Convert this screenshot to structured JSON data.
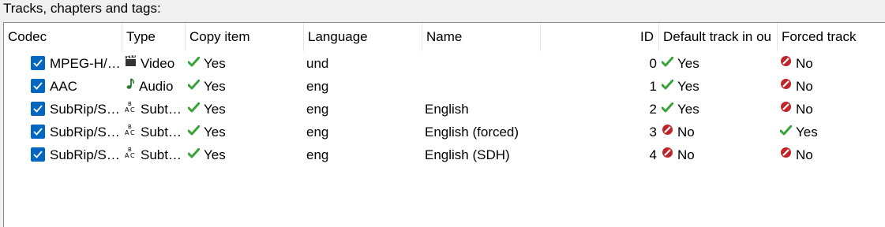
{
  "section_label": "Tracks, chapters and tags:",
  "columns": {
    "codec": "Codec",
    "type": "Type",
    "copy": "Copy item",
    "language": "Language",
    "name": "Name",
    "id": "ID",
    "default": "Default track in ou",
    "forced": "Forced track"
  },
  "rows": [
    {
      "checked": true,
      "codec": "MPEG-H/…",
      "type_icon": "video-clapper-icon",
      "type": "Video",
      "copy": "Yes",
      "copy_icon": "check-icon",
      "language": "und",
      "name": "",
      "id": "0",
      "default": "Yes",
      "default_icon": "check-icon",
      "forced": "No",
      "forced_icon": "no-icon"
    },
    {
      "checked": true,
      "codec": "AAC",
      "type_icon": "audio-note-icon",
      "type": "Audio",
      "copy": "Yes",
      "copy_icon": "check-icon",
      "language": "eng",
      "name": "",
      "id": "1",
      "default": "Yes",
      "default_icon": "check-icon",
      "forced": "No",
      "forced_icon": "no-icon"
    },
    {
      "checked": true,
      "codec": "SubRip/S…",
      "type_icon": "subtitle-icon",
      "type": "Subt…",
      "copy": "Yes",
      "copy_icon": "check-icon",
      "language": "eng",
      "name": "English",
      "id": "2",
      "default": "Yes",
      "default_icon": "check-icon",
      "forced": "No",
      "forced_icon": "no-icon"
    },
    {
      "checked": true,
      "codec": "SubRip/S…",
      "type_icon": "subtitle-icon",
      "type": "Subt…",
      "copy": "Yes",
      "copy_icon": "check-icon",
      "language": "eng",
      "name": "English (forced)",
      "id": "3",
      "default": "No",
      "default_icon": "no-icon",
      "forced": "Yes",
      "forced_icon": "check-icon"
    },
    {
      "checked": true,
      "codec": "SubRip/S…",
      "type_icon": "subtitle-icon",
      "type": "Subt…",
      "copy": "Yes",
      "copy_icon": "check-icon",
      "language": "eng",
      "name": "English (SDH)",
      "id": "4",
      "default": "No",
      "default_icon": "no-icon",
      "forced": "No",
      "forced_icon": "no-icon"
    }
  ],
  "colors": {
    "checkbox": "#0067c0",
    "check": "#3aa23a",
    "no": "#c0252a"
  }
}
